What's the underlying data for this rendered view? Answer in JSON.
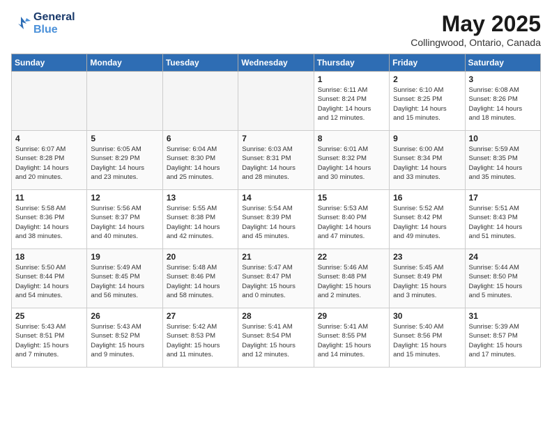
{
  "header": {
    "logo_line1": "General",
    "logo_line2": "Blue",
    "month": "May 2025",
    "location": "Collingwood, Ontario, Canada"
  },
  "days_of_week": [
    "Sunday",
    "Monday",
    "Tuesday",
    "Wednesday",
    "Thursday",
    "Friday",
    "Saturday"
  ],
  "weeks": [
    [
      {
        "num": "",
        "data": ""
      },
      {
        "num": "",
        "data": ""
      },
      {
        "num": "",
        "data": ""
      },
      {
        "num": "",
        "data": ""
      },
      {
        "num": "1",
        "data": "Sunrise: 6:11 AM\nSunset: 8:24 PM\nDaylight: 14 hours\nand 12 minutes."
      },
      {
        "num": "2",
        "data": "Sunrise: 6:10 AM\nSunset: 8:25 PM\nDaylight: 14 hours\nand 15 minutes."
      },
      {
        "num": "3",
        "data": "Sunrise: 6:08 AM\nSunset: 8:26 PM\nDaylight: 14 hours\nand 18 minutes."
      }
    ],
    [
      {
        "num": "4",
        "data": "Sunrise: 6:07 AM\nSunset: 8:28 PM\nDaylight: 14 hours\nand 20 minutes."
      },
      {
        "num": "5",
        "data": "Sunrise: 6:05 AM\nSunset: 8:29 PM\nDaylight: 14 hours\nand 23 minutes."
      },
      {
        "num": "6",
        "data": "Sunrise: 6:04 AM\nSunset: 8:30 PM\nDaylight: 14 hours\nand 25 minutes."
      },
      {
        "num": "7",
        "data": "Sunrise: 6:03 AM\nSunset: 8:31 PM\nDaylight: 14 hours\nand 28 minutes."
      },
      {
        "num": "8",
        "data": "Sunrise: 6:01 AM\nSunset: 8:32 PM\nDaylight: 14 hours\nand 30 minutes."
      },
      {
        "num": "9",
        "data": "Sunrise: 6:00 AM\nSunset: 8:34 PM\nDaylight: 14 hours\nand 33 minutes."
      },
      {
        "num": "10",
        "data": "Sunrise: 5:59 AM\nSunset: 8:35 PM\nDaylight: 14 hours\nand 35 minutes."
      }
    ],
    [
      {
        "num": "11",
        "data": "Sunrise: 5:58 AM\nSunset: 8:36 PM\nDaylight: 14 hours\nand 38 minutes."
      },
      {
        "num": "12",
        "data": "Sunrise: 5:56 AM\nSunset: 8:37 PM\nDaylight: 14 hours\nand 40 minutes."
      },
      {
        "num": "13",
        "data": "Sunrise: 5:55 AM\nSunset: 8:38 PM\nDaylight: 14 hours\nand 42 minutes."
      },
      {
        "num": "14",
        "data": "Sunrise: 5:54 AM\nSunset: 8:39 PM\nDaylight: 14 hours\nand 45 minutes."
      },
      {
        "num": "15",
        "data": "Sunrise: 5:53 AM\nSunset: 8:40 PM\nDaylight: 14 hours\nand 47 minutes."
      },
      {
        "num": "16",
        "data": "Sunrise: 5:52 AM\nSunset: 8:42 PM\nDaylight: 14 hours\nand 49 minutes."
      },
      {
        "num": "17",
        "data": "Sunrise: 5:51 AM\nSunset: 8:43 PM\nDaylight: 14 hours\nand 51 minutes."
      }
    ],
    [
      {
        "num": "18",
        "data": "Sunrise: 5:50 AM\nSunset: 8:44 PM\nDaylight: 14 hours\nand 54 minutes."
      },
      {
        "num": "19",
        "data": "Sunrise: 5:49 AM\nSunset: 8:45 PM\nDaylight: 14 hours\nand 56 minutes."
      },
      {
        "num": "20",
        "data": "Sunrise: 5:48 AM\nSunset: 8:46 PM\nDaylight: 14 hours\nand 58 minutes."
      },
      {
        "num": "21",
        "data": "Sunrise: 5:47 AM\nSunset: 8:47 PM\nDaylight: 15 hours\nand 0 minutes."
      },
      {
        "num": "22",
        "data": "Sunrise: 5:46 AM\nSunset: 8:48 PM\nDaylight: 15 hours\nand 2 minutes."
      },
      {
        "num": "23",
        "data": "Sunrise: 5:45 AM\nSunset: 8:49 PM\nDaylight: 15 hours\nand 3 minutes."
      },
      {
        "num": "24",
        "data": "Sunrise: 5:44 AM\nSunset: 8:50 PM\nDaylight: 15 hours\nand 5 minutes."
      }
    ],
    [
      {
        "num": "25",
        "data": "Sunrise: 5:43 AM\nSunset: 8:51 PM\nDaylight: 15 hours\nand 7 minutes."
      },
      {
        "num": "26",
        "data": "Sunrise: 5:43 AM\nSunset: 8:52 PM\nDaylight: 15 hours\nand 9 minutes."
      },
      {
        "num": "27",
        "data": "Sunrise: 5:42 AM\nSunset: 8:53 PM\nDaylight: 15 hours\nand 11 minutes."
      },
      {
        "num": "28",
        "data": "Sunrise: 5:41 AM\nSunset: 8:54 PM\nDaylight: 15 hours\nand 12 minutes."
      },
      {
        "num": "29",
        "data": "Sunrise: 5:41 AM\nSunset: 8:55 PM\nDaylight: 15 hours\nand 14 minutes."
      },
      {
        "num": "30",
        "data": "Sunrise: 5:40 AM\nSunset: 8:56 PM\nDaylight: 15 hours\nand 15 minutes."
      },
      {
        "num": "31",
        "data": "Sunrise: 5:39 AM\nSunset: 8:57 PM\nDaylight: 15 hours\nand 17 minutes."
      }
    ]
  ]
}
